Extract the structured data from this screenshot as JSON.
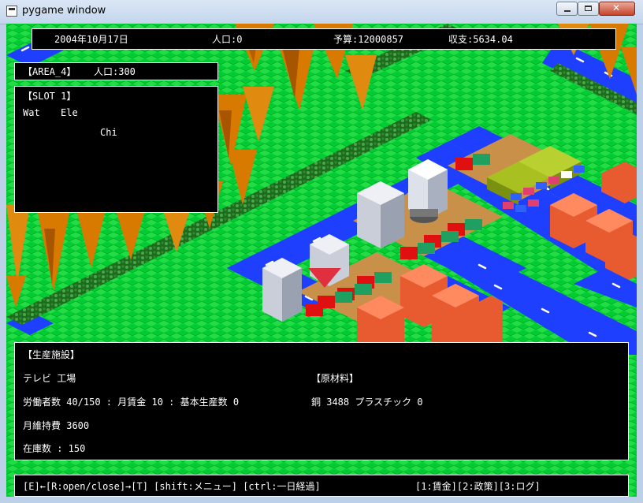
{
  "window": {
    "title": "pygame window"
  },
  "status": {
    "date": "2004年10月17日",
    "population": "人口:0",
    "budget": "予算:12000857",
    "balance": "収支:5634.04"
  },
  "area": {
    "label": "【AREA_4】",
    "population": "人口:300"
  },
  "slot": {
    "title": "【SLOT 1】",
    "item1": "Wat",
    "item2": "Ele",
    "item3": "Chi"
  },
  "facility": {
    "heading": "【生産施設】",
    "name": "テレビ 工場",
    "workers": "労働者数 40/150 : 月賃金 10 : 基本生産数 0",
    "upkeep": "月維持費 3600",
    "stock": "在庫数 : 150",
    "materials_heading": "【原材料】",
    "materials": "銅 3488 プラスチック 0"
  },
  "keys": {
    "left": "[E]←[R:open/close]→[T]  [shift:メニュー]  [ctrl:一日経過]",
    "right": "[1:賃金][2:政策][3:ログ]"
  },
  "colors": {
    "grass": "#00cc33",
    "road": "#1f3fff",
    "tree": "#d97a00",
    "panel": "#000000"
  }
}
